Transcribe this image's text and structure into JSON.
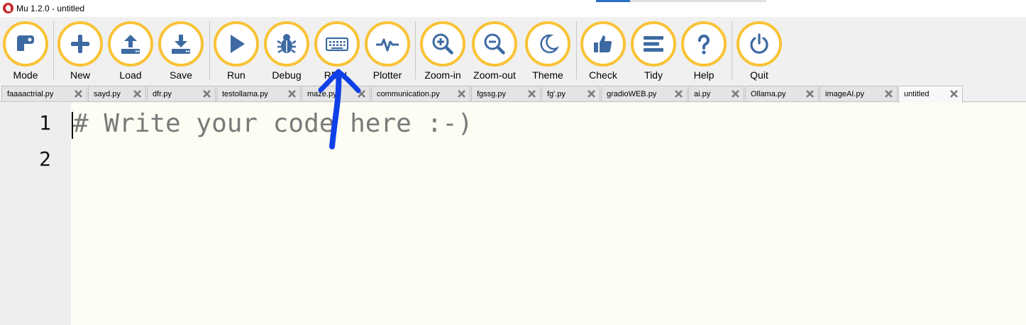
{
  "window": {
    "title": "Mu 1.2.0 - untitled"
  },
  "toolbar": {
    "buttons": [
      {
        "label": "Mode",
        "icon": "mode-icon"
      },
      {
        "label": "New",
        "icon": "plus-icon"
      },
      {
        "label": "Load",
        "icon": "upload-icon"
      },
      {
        "label": "Save",
        "icon": "download-icon"
      },
      {
        "label": "Run",
        "icon": "play-icon"
      },
      {
        "label": "Debug",
        "icon": "bug-icon"
      },
      {
        "label": "REPL",
        "icon": "keyboard-icon"
      },
      {
        "label": "Plotter",
        "icon": "pulse-icon"
      },
      {
        "label": "Zoom-in",
        "icon": "zoom-in-icon"
      },
      {
        "label": "Zoom-out",
        "icon": "zoom-out-icon"
      },
      {
        "label": "Theme",
        "icon": "moon-icon"
      },
      {
        "label": "Check",
        "icon": "thumbs-up-icon"
      },
      {
        "label": "Tidy",
        "icon": "lines-icon"
      },
      {
        "label": "Help",
        "icon": "question-icon"
      },
      {
        "label": "Quit",
        "icon": "power-icon"
      }
    ]
  },
  "tabs": [
    {
      "label": "faaaactrial.py"
    },
    {
      "label": "sayd.py"
    },
    {
      "label": "dfr.py"
    },
    {
      "label": "testollama.py"
    },
    {
      "label": "maze.py"
    },
    {
      "label": "communication.py"
    },
    {
      "label": "fgssg.py"
    },
    {
      "label": "fg'.py"
    },
    {
      "label": "gradioWEB.py"
    },
    {
      "label": "ai.py"
    },
    {
      "label": "Ollama.py"
    },
    {
      "label": "imageAI.py"
    },
    {
      "label": "untitled",
      "active": true
    }
  ],
  "editor": {
    "lines": [
      "1",
      "2"
    ],
    "placeholder": "# Write your code here :-)"
  },
  "colors": {
    "accent_ring": "#f9c336",
    "icon_blue": "#3d6aa2",
    "editor_bg": "#fefdf4",
    "annotation_arrow": "#1040e8"
  }
}
